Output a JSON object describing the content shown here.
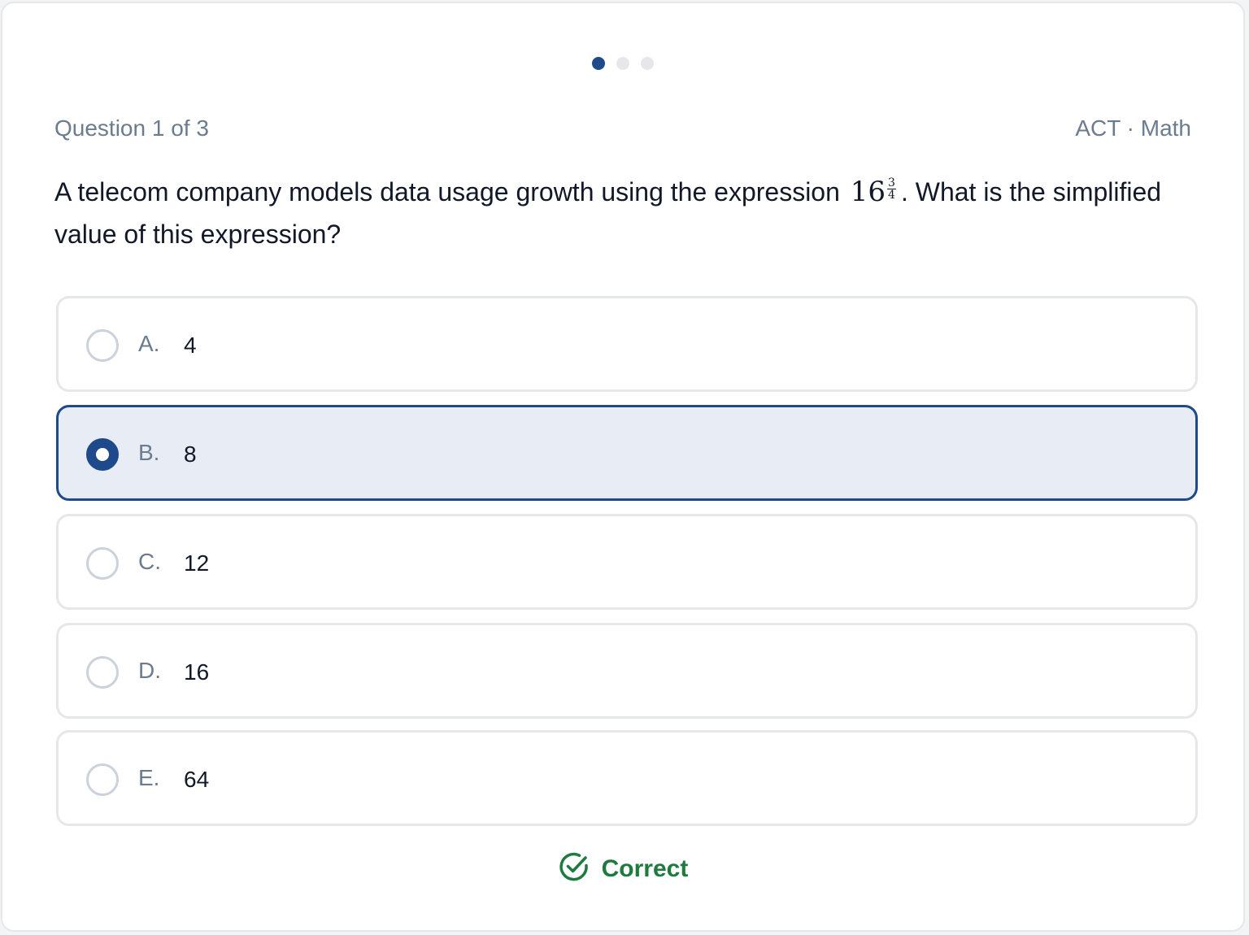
{
  "progress": {
    "total": 3,
    "current": 1,
    "active_color": "#1e4a8c",
    "inactive_color": "#e5e7eb"
  },
  "header": {
    "question_counter": "Question 1 of 3",
    "category": "ACT · Math"
  },
  "question": {
    "text_before": "A telecom company models data usage growth using the expression",
    "expression_base": "16",
    "exponent_numerator": "3",
    "exponent_denominator": "4",
    "text_after": ". What is the simplified value of this expression?"
  },
  "options": [
    {
      "letter": "A.",
      "value": "4",
      "selected": false
    },
    {
      "letter": "B.",
      "value": "8",
      "selected": true
    },
    {
      "letter": "C.",
      "value": "12",
      "selected": false
    },
    {
      "letter": "D.",
      "value": "16",
      "selected": false
    },
    {
      "letter": "E.",
      "value": "64",
      "selected": false
    }
  ],
  "feedback": {
    "label": "Correct",
    "icon": "check-circle-icon",
    "color": "#1f7a3e"
  },
  "colors": {
    "accent": "#1e4a8c",
    "selected_bg": "#e8edf5",
    "muted_text": "#6b7c8f"
  }
}
